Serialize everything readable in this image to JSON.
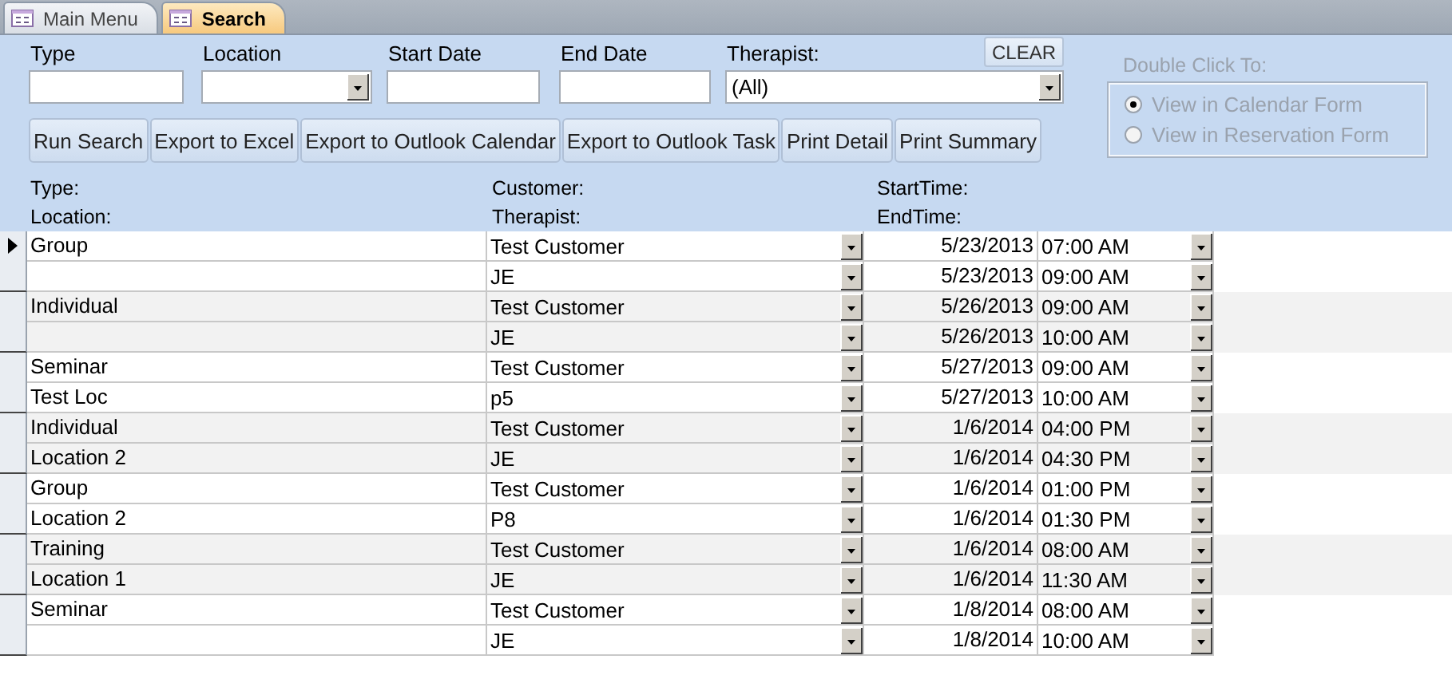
{
  "tabs": [
    {
      "label": "Main Menu",
      "selected": false
    },
    {
      "label": "Search",
      "selected": true
    }
  ],
  "filters": [
    {
      "label": "Type",
      "kind": "text"
    },
    {
      "label": "Location",
      "kind": "combo"
    },
    {
      "label": "Start Date",
      "kind": "text"
    },
    {
      "label": "End Date",
      "kind": "text"
    },
    {
      "label": "Therapist:",
      "kind": "combo",
      "value": "(All)"
    }
  ],
  "clear_button": "CLEAR",
  "buttons": [
    "Run Search",
    "Export to Excel",
    "Export to Outlook Calendar",
    "Export to Outlook Task",
    "Print Detail",
    "Print Summary"
  ],
  "double_click": {
    "label": "Double Click To:",
    "disabled": true,
    "options": [
      {
        "label": "View in Calendar Form",
        "selected": true
      },
      {
        "label": "View in Reservation Form",
        "selected": false
      }
    ]
  },
  "field_labels": {
    "type": "Type:",
    "location": "Location:",
    "customer": "Customer:",
    "therapist": "Therapist:",
    "start_time": "StartTime:",
    "end_time": "EndTime:"
  },
  "records": [
    {
      "current": true,
      "type": "Group",
      "customer": "Test Customer",
      "therapist": "JE",
      "start_date": "5/23/2013",
      "start_time": "07:00 AM",
      "end_date": "5/23/2013",
      "end_time": "09:00 AM"
    },
    {
      "current": false,
      "type": "Individual",
      "customer": "Test Customer",
      "therapist": "JE",
      "start_date": "5/26/2013",
      "start_time": "09:00 AM",
      "end_date": "5/26/2013",
      "end_time": "10:00 AM"
    },
    {
      "current": false,
      "type": "Seminar",
      "location": "Test Loc",
      "customer": "Test Customer",
      "therapist": "p5",
      "start_date": "5/27/2013",
      "start_time": "09:00 AM",
      "end_date": "5/27/2013",
      "end_time": "10:00 AM"
    },
    {
      "current": false,
      "type": "Individual",
      "location": "Location 2",
      "customer": "Test Customer",
      "therapist": "JE",
      "start_date": "1/6/2014",
      "start_time": "04:00 PM",
      "end_date": "1/6/2014",
      "end_time": "04:30 PM"
    },
    {
      "current": false,
      "type": "Group",
      "location": "Location 2",
      "customer": "Test Customer",
      "therapist": "P8",
      "start_date": "1/6/2014",
      "start_time": "01:00 PM",
      "end_date": "1/6/2014",
      "end_time": "01:30 PM"
    },
    {
      "current": false,
      "type": "Training",
      "location": "Location 1",
      "customer": "Test Customer",
      "therapist": "JE",
      "start_date": "1/6/2014",
      "start_time": "08:00 AM",
      "end_date": "1/6/2014",
      "end_time": "11:30 AM"
    },
    {
      "current": false,
      "type": "Seminar",
      "customer": "Test Customer",
      "therapist": "JE",
      "start_date": "1/8/2014",
      "start_time": "08:00 AM",
      "end_date": "1/8/2014",
      "end_time": "10:00 AM"
    }
  ]
}
